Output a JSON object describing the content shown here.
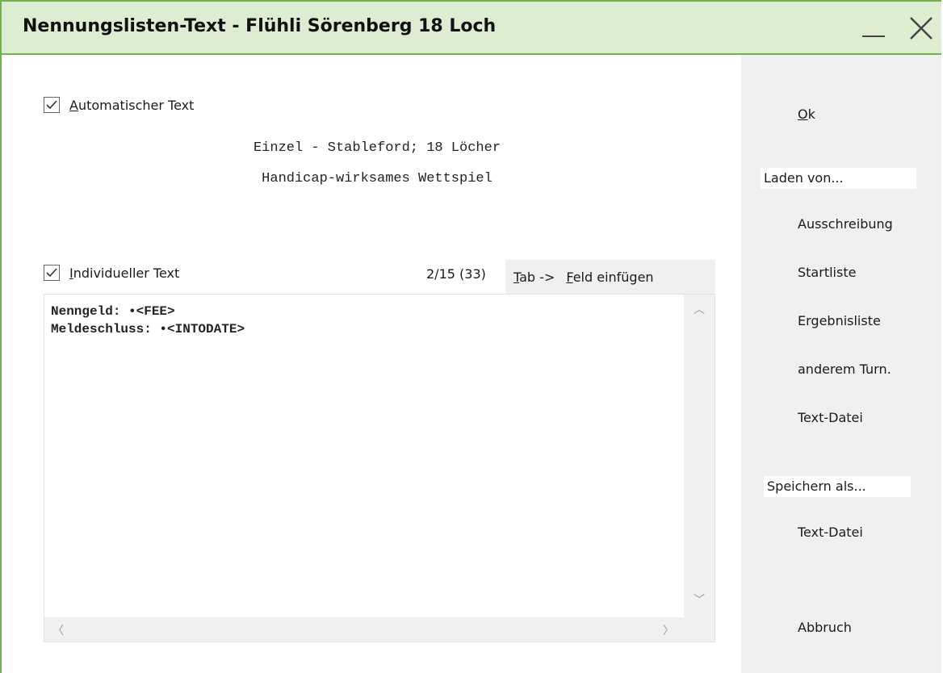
{
  "window": {
    "title": "Nennungslisten-Text - Flühli Sörenberg 18 Loch"
  },
  "automatic": {
    "checked": true,
    "label_first": "A",
    "label_rest": "utomatischer Text",
    "line1": "Einzel - Stableford; 18 Löcher",
    "line2": "Handicap-wirksames Wettspiel"
  },
  "individual": {
    "checked": true,
    "label_first": "I",
    "label_rest": "ndividueller Text",
    "counter": "2/15 (33)",
    "tab_first": "T",
    "tab_rest": "ab ->",
    "insert_first": "F",
    "insert_rest": "eld einfügen",
    "lines": [
      "Nenngeld: •<FEE>",
      "Meldeschluss: •<INTODATE>"
    ]
  },
  "side": {
    "ok_first": "O",
    "ok_rest": "k",
    "load_from": "Laden von...",
    "load_items": [
      "Ausschreibung",
      "Startliste",
      "Ergebnisliste",
      "anderem Turn.",
      "Text-Datei"
    ],
    "save_as": "Speichern als...",
    "save_items": [
      "Text-Datei"
    ],
    "cancel": "Abbruch"
  }
}
